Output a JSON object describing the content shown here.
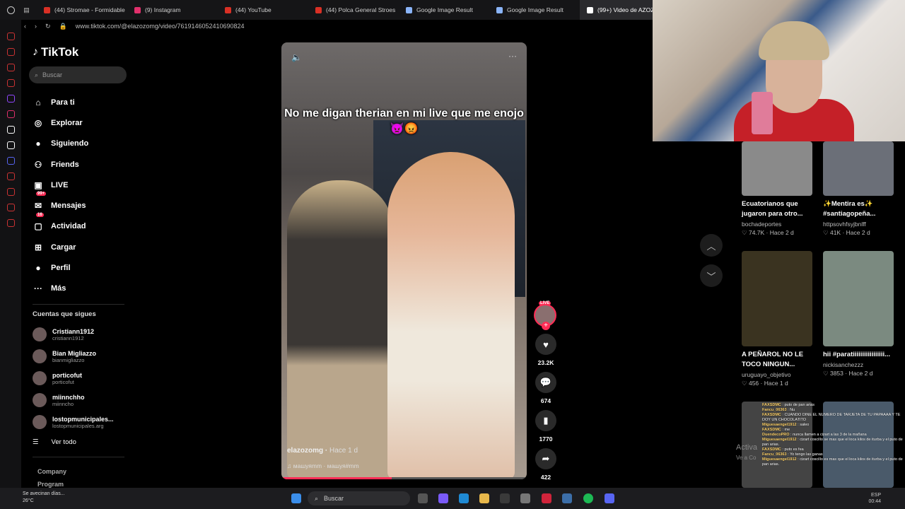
{
  "browser": {
    "tabs": [
      {
        "label": "(44) Stromae - Formidable",
        "color": "#d93025"
      },
      {
        "label": "(9) Instagram",
        "color": "#e1306c"
      },
      {
        "label": "(44) YouTube",
        "color": "#d93025"
      },
      {
        "label": "(44) Polca General Stroes",
        "color": "#d93025"
      },
      {
        "label": "Google Image Result",
        "color": "#8ab4f8"
      },
      {
        "label": "Google Image Result",
        "color": "#8ab4f8"
      },
      {
        "label": "(99+) Video de AZOZ",
        "color": "#ffffff"
      }
    ],
    "url": "www.tiktok.com/@elazozomg/video/7619146052410690824"
  },
  "sidebar": {
    "logo": "TikTok",
    "search_placeholder": "Buscar",
    "nav": [
      {
        "label": "Para ti",
        "icon": "home-icon",
        "glyph": "⌂"
      },
      {
        "label": "Explorar",
        "icon": "compass-icon",
        "glyph": "◎"
      },
      {
        "label": "Siguiendo",
        "icon": "following-avatar-icon",
        "glyph": "●"
      },
      {
        "label": "Friends",
        "icon": "friends-icon",
        "glyph": "⚇"
      },
      {
        "label": "LIVE",
        "icon": "live-icon",
        "glyph": "▣"
      },
      {
        "label": "Mensajes",
        "icon": "messages-icon",
        "glyph": "✉",
        "badge": "99+"
      },
      {
        "label": "Actividad",
        "icon": "activity-icon",
        "glyph": "▢",
        "badge": "16"
      },
      {
        "label": "Cargar",
        "icon": "upload-icon",
        "glyph": "⊞"
      },
      {
        "label": "Perfil",
        "icon": "profile-icon",
        "glyph": "●"
      },
      {
        "label": "Más",
        "icon": "more-icon",
        "glyph": "···"
      }
    ],
    "following_heading": "Cuentas que sigues",
    "accounts": [
      {
        "name": "Cristiann1912",
        "handle": "cristiann1912"
      },
      {
        "name": "Bian Migliazzo",
        "handle": "bianmigliazzo"
      },
      {
        "name": "porticofut",
        "handle": "porticofut"
      },
      {
        "name": "miinnchho",
        "handle": "miinncho"
      },
      {
        "name": "lostopmunicipales...",
        "handle": "lostopmunicipales.arg"
      }
    ],
    "see_all": "Ver todo",
    "footer": [
      "Company",
      "Program"
    ]
  },
  "video": {
    "caption": "No me digan therian en mi live que me enojo 👿😡",
    "author": "elazozomg",
    "time": "Hace 1 d",
    "music": "машуяmm · машуя#mm",
    "progress": 0.45
  },
  "actions": {
    "live_label": "LIVE",
    "likes": "23.2K",
    "comments": "674",
    "saves": "1770",
    "shares": "422"
  },
  "related": [
    {
      "title": "Ecuatorianos que jugaron para otro...",
      "user": "bochadeportes",
      "meta": "♡ 74.7K · Hace 2 d"
    },
    {
      "title": "✨Mentira es✨ #santiagopeña...",
      "user": "httpsovhfsyjbnlff",
      "meta": "♡ 41K · Hace 2 d"
    },
    {
      "title": "A PEÑAROL NO LE TOCO NINGUN...",
      "user": "uruguayo_objetivo",
      "meta": "♡ 456 · Hace 1 d"
    },
    {
      "title": "hii #paratiiiiiiiiiiiiiiiii...",
      "user": "nickisanchezzz",
      "meta": "♡ 3853 · Hace 2 d"
    }
  ],
  "overlay": {
    "chat": [
      {
        "user": "FAXSDMC",
        "msg": "puto de pan arias"
      },
      {
        "user": "Fancu_06363",
        "msg": "Nu"
      },
      {
        "user": "FAXSDMC",
        "msg": "CUANDO DINE EL NUMERO DE TARJETA DE TU PAPAAAA Y TE DOY UN CHOCOLATITO"
      },
      {
        "user": "Miguesaengel1912",
        "msg": "saleo"
      },
      {
        "user": "FAXSDMC",
        "msg": "me"
      },
      {
        "user": "DuendecoPRO",
        "msg": "nunca llamen a cizart a las 3 de la mañana"
      },
      {
        "user": "Miguesaengel1912",
        "msg": "cizart coscillo se mas que el loca kilos de iturba y el puto de pan arias."
      },
      {
        "user": "FAXSDMC",
        "msg": "puto es fea"
      },
      {
        "user": "Fancu_06363",
        "msg": "Yo tengo las ganas"
      },
      {
        "user": "Miguesaengel1912",
        "msg": "cizart coscillo es mas que el loca kilos de iturba y el puto de pan arias."
      }
    ],
    "activate_title": "Activa",
    "activate_sub": "Ve a Co"
  },
  "taskbar": {
    "weather": "Se avecinan días...",
    "temp": "26°C",
    "search_placeholder": "Buscar",
    "lang": "ESP",
    "time": "00:44"
  }
}
